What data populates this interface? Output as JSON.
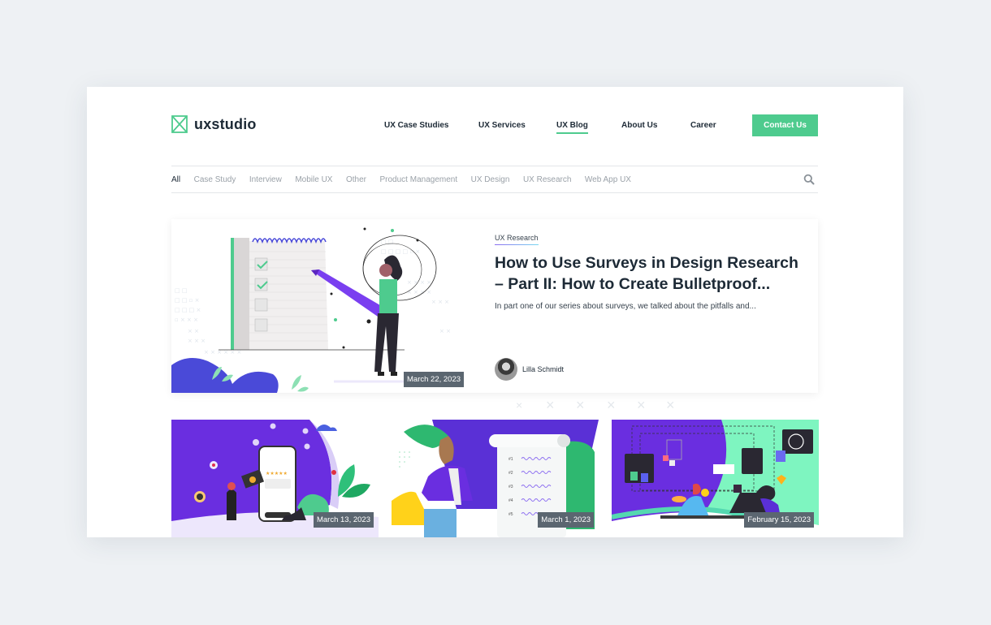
{
  "header": {
    "logo_text": "uxstudio",
    "nav": [
      {
        "label": "UX Case Studies",
        "active": false
      },
      {
        "label": "UX Services",
        "active": false
      },
      {
        "label": "UX Blog",
        "active": true
      },
      {
        "label": "About Us",
        "active": false
      },
      {
        "label": "Career",
        "active": false
      }
    ],
    "cta_label": "Contact Us"
  },
  "filters": {
    "items": [
      "All",
      "Case Study",
      "Interview",
      "Mobile UX",
      "Other",
      "Product Management",
      "UX Design",
      "UX Research",
      "Web App UX"
    ],
    "active": "All"
  },
  "featured": {
    "category": "UX Research",
    "title": "How to Use Surveys in Design Research – Part II: How to Create Bulletproof...",
    "excerpt": "In part one of our series about surveys, we talked about the pitfalls and...",
    "author": "Lilla Schmidt",
    "date": "March 22, 2023"
  },
  "cards": [
    {
      "date": "March 13, 2023"
    },
    {
      "date": "March 1, 2023"
    },
    {
      "date": "February 15, 2023"
    }
  ],
  "colors": {
    "brand_green": "#4ecb8e",
    "purple": "#6a2ee0",
    "mint": "#7ef5c0",
    "text_dark": "#1d2a36"
  }
}
